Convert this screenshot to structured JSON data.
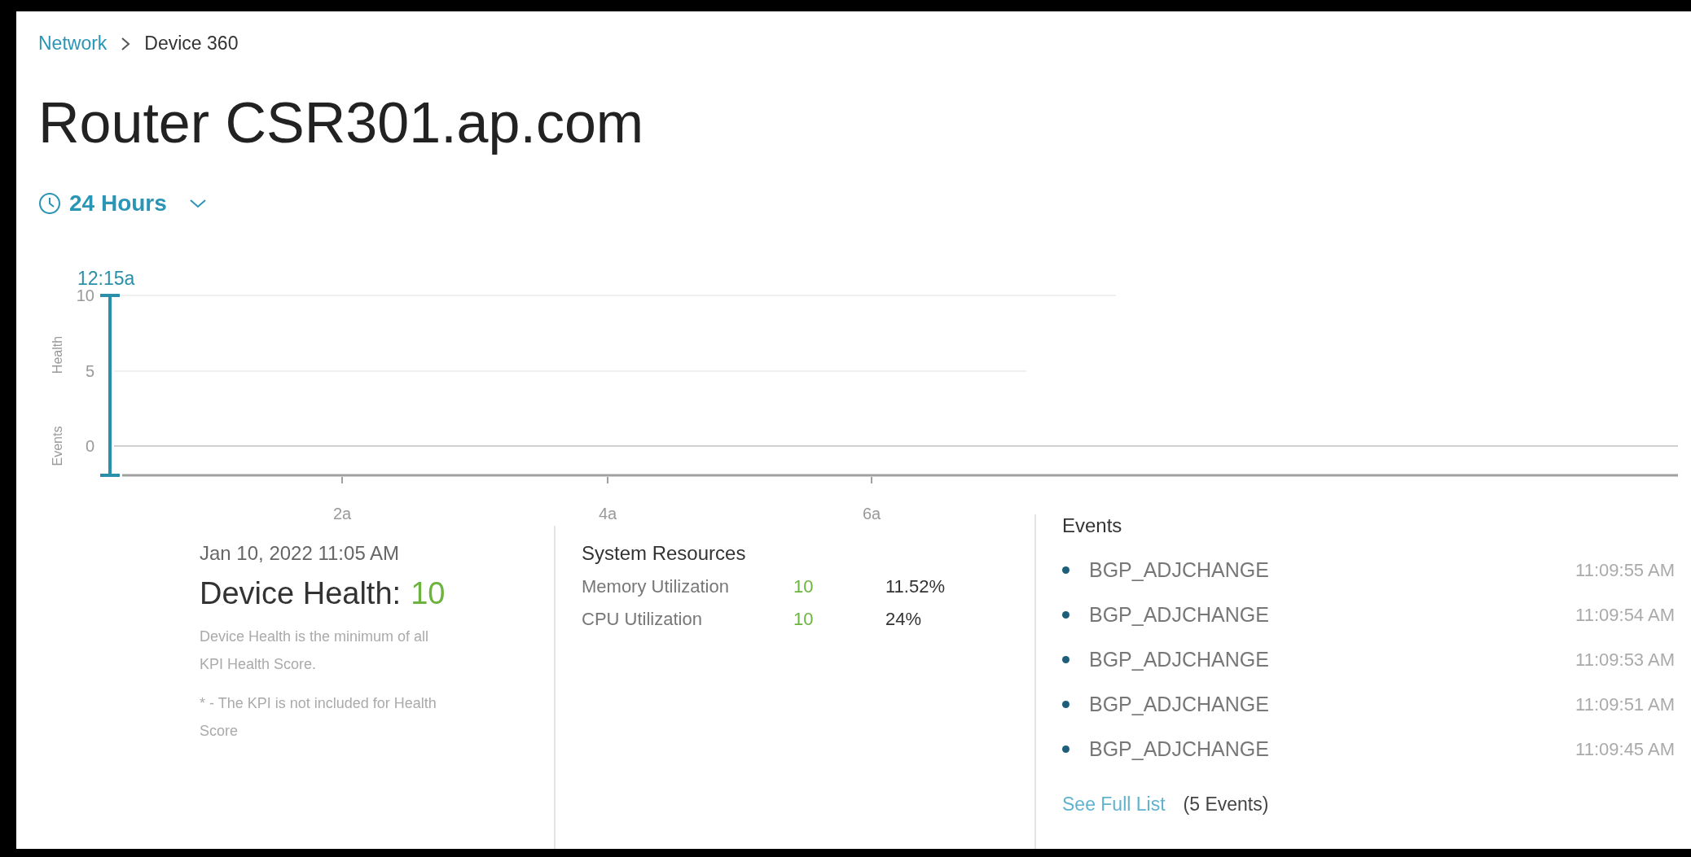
{
  "breadcrumb": [
    {
      "label": "Network",
      "kind": "link"
    },
    {
      "label": "Device 360",
      "kind": "current"
    }
  ],
  "title": "Router CSR301.ap.com",
  "time_range": {
    "label": "24 Hours"
  },
  "chart": {
    "y_axis_labels": [
      "Health",
      "Events"
    ],
    "y_ticks": [
      "10",
      "5",
      "0"
    ],
    "x_ticks": [
      "2a",
      "4a",
      "6a"
    ],
    "cursor_label": "12:15a"
  },
  "summary": {
    "timestamp": "Jan 10, 2022 11:05 AM",
    "health_label": "Device Health:",
    "health_value": "10",
    "notes": [
      "Device Health is the minimum of all KPI Health Score.",
      "* - The KPI is not included for Health Score"
    ]
  },
  "system_resources": {
    "title": "System Resources",
    "rows": [
      {
        "name": "Memory Utilization",
        "score": "10",
        "value": "11.52%"
      },
      {
        "name": "CPU Utilization",
        "score": "10",
        "value": "24%"
      }
    ]
  },
  "events": {
    "title": "Events",
    "items": [
      {
        "name": "BGP_ADJCHANGE",
        "time": "11:09:55 AM"
      },
      {
        "name": "BGP_ADJCHANGE",
        "time": "11:09:54 AM"
      },
      {
        "name": "BGP_ADJCHANGE",
        "time": "11:09:53 AM"
      },
      {
        "name": "BGP_ADJCHANGE",
        "time": "11:09:51 AM"
      },
      {
        "name": "BGP_ADJCHANGE",
        "time": "11:09:45 AM"
      }
    ],
    "link": "See Full List",
    "count": "(5 Events)"
  }
}
